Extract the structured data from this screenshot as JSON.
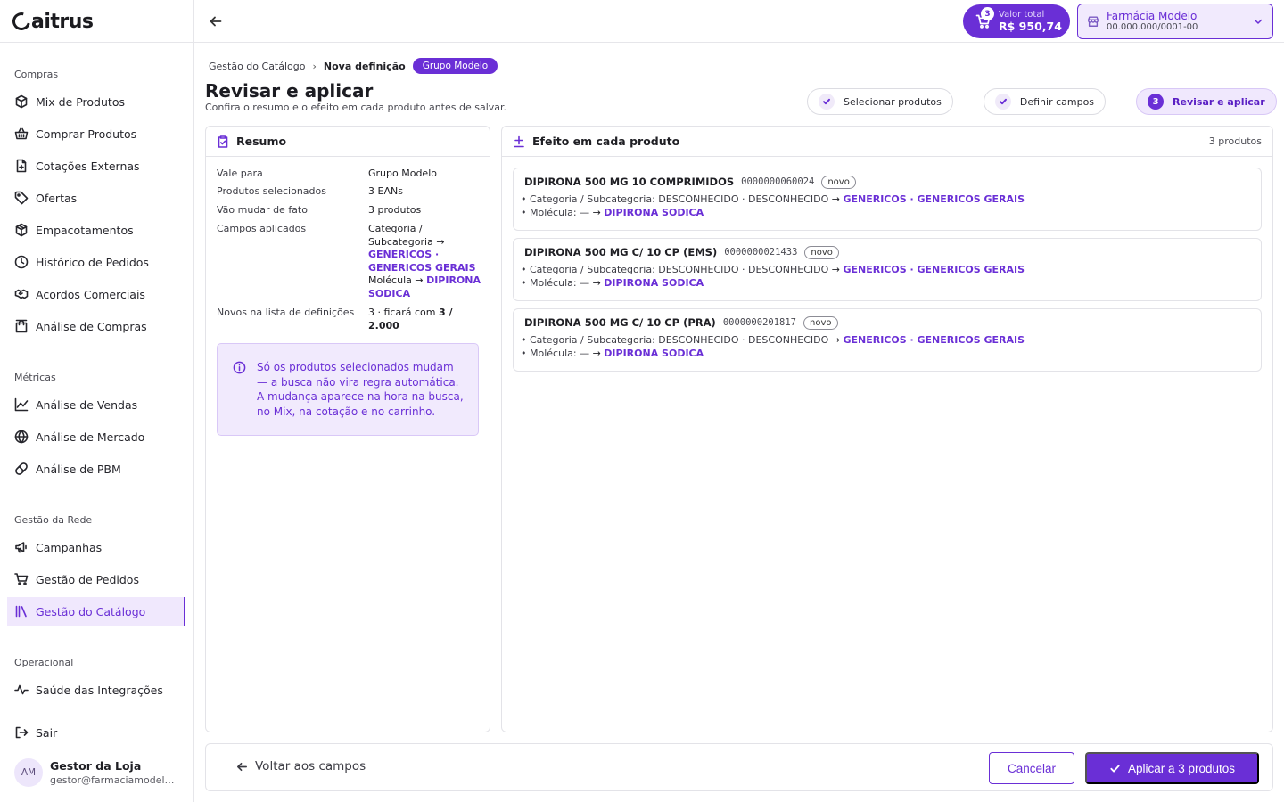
{
  "app": {
    "logo_text": "aitrus"
  },
  "sidebar": {
    "sections": [
      {
        "label": "Compras"
      },
      {
        "label": "Métricas"
      },
      {
        "label": "Gestão da Rede"
      },
      {
        "label": "Operacional"
      }
    ],
    "items": [
      {
        "label": "Mix de Produtos",
        "icon": "box-icon"
      },
      {
        "label": "Comprar Produtos",
        "icon": "basket-icon"
      },
      {
        "label": "Cotações Externas",
        "icon": "document-plus-icon"
      },
      {
        "label": "Ofertas",
        "icon": "tag-icon"
      },
      {
        "label": "Empacotamentos",
        "icon": "package-icon"
      },
      {
        "label": "Histórico de Pedidos",
        "icon": "clock-icon"
      },
      {
        "label": "Acordos Comerciais",
        "icon": "handshake-icon"
      },
      {
        "label": "Análise de Compras",
        "icon": "shopping-bag-icon"
      },
      {
        "label": "Análise de Vendas",
        "icon": "line-chart-icon"
      },
      {
        "label": "Análise de Mercado",
        "icon": "globe-icon"
      },
      {
        "label": "Análise de PBM",
        "icon": "pill-icon"
      },
      {
        "label": "Campanhas",
        "icon": "megaphone-icon"
      },
      {
        "label": "Gestão de Pedidos",
        "icon": "cart-icon"
      },
      {
        "label": "Gestão do Catálogo",
        "icon": "library-icon"
      },
      {
        "label": "Saúde das Integrações",
        "icon": "activity-icon"
      },
      {
        "label": "Sair",
        "icon": "logout-icon"
      }
    ],
    "active_item": "Gestão do Catálogo",
    "user": {
      "initials": "AM",
      "name": "Gestor da Loja",
      "email": "gestor@farmaciamodelo.com.br"
    }
  },
  "topbar": {
    "cart": {
      "count": "3",
      "label": "Valor total",
      "value": "R$ 950,74"
    },
    "store": {
      "name": "Farmácia Modelo",
      "cnpj": "00.000.000/0001-00"
    }
  },
  "breadcrumb": {
    "parent": "Gestão do Catálogo",
    "current": "Nova definição",
    "pill": "Grupo Modelo"
  },
  "page": {
    "title": "Revisar e aplicar",
    "subtitle": "Confira o resumo e o efeito em cada produto antes de salvar."
  },
  "steps": [
    {
      "label": "Selecionar produtos",
      "state": "done"
    },
    {
      "label": "Definir campos",
      "state": "done"
    },
    {
      "label": "Revisar e aplicar",
      "state": "active",
      "number": "3"
    }
  ],
  "summary": {
    "title": "Resumo",
    "rows": {
      "vale_para": {
        "key": "Vale para",
        "value": "Grupo Modelo"
      },
      "selecionados": {
        "key": "Produtos selecionados",
        "value": "3 EANs"
      },
      "vao_mudar": {
        "key": "Vão mudar de fato",
        "value": "3 produtos"
      },
      "campos": {
        "key": "Campos aplicados",
        "cat_label": "Categoria / Subcategoria →",
        "cat_value": "GENERICOS · GENERICOS GERAIS",
        "mol_label": "Molécula →",
        "mol_value": "DIPIRONA SODICA"
      },
      "novos": {
        "key": "Novos na lista de definições",
        "prefix": "3 · ficará com",
        "bold": "3 / 2.000"
      }
    },
    "info": "Só os produtos selecionados mudam — a busca não vira regra automática. A mudança aparece na hora na busca, no Mix, na cotação e no carrinho."
  },
  "effect": {
    "title": "Efeito em cada produto",
    "count": "3 produtos",
    "products": [
      {
        "name": "DIPIRONA 500 MG 10 COMPRIMIDOS",
        "ean": "0000000060024",
        "tag": "novo",
        "cat_prefix": "Categoria / Subcategoria: DESCONHECIDO · DESCONHECIDO",
        "cat_new": "GENERICOS · GENERICOS GERAIS",
        "mol_prefix": "Molécula: —",
        "mol_new": "DIPIRONA SODICA"
      },
      {
        "name": "DIPIRONA 500 MG C/ 10 CP (EMS)",
        "ean": "0000000021433",
        "tag": "novo",
        "cat_prefix": "Categoria / Subcategoria: DESCONHECIDO · DESCONHECIDO",
        "cat_new": "GENERICOS · GENERICOS GERAIS",
        "mol_prefix": "Molécula: —",
        "mol_new": "DIPIRONA SODICA"
      },
      {
        "name": "DIPIRONA 500 MG C/ 10 CP (PRA)",
        "ean": "0000000201817",
        "tag": "novo",
        "cat_prefix": "Categoria / Subcategoria: DESCONHECIDO · DESCONHECIDO",
        "cat_new": "GENERICOS · GENERICOS GERAIS",
        "mol_prefix": "Molécula: —",
        "mol_new": "DIPIRONA SODICA"
      }
    ]
  },
  "footer": {
    "back_label": "Voltar aos campos",
    "cancel_label": "Cancelar",
    "apply_label": "Aplicar a 3 produtos"
  },
  "colors": {
    "accent": "#6a2fd6",
    "accent_soft": "#f0e8fd",
    "border": "#e3e3e8"
  }
}
